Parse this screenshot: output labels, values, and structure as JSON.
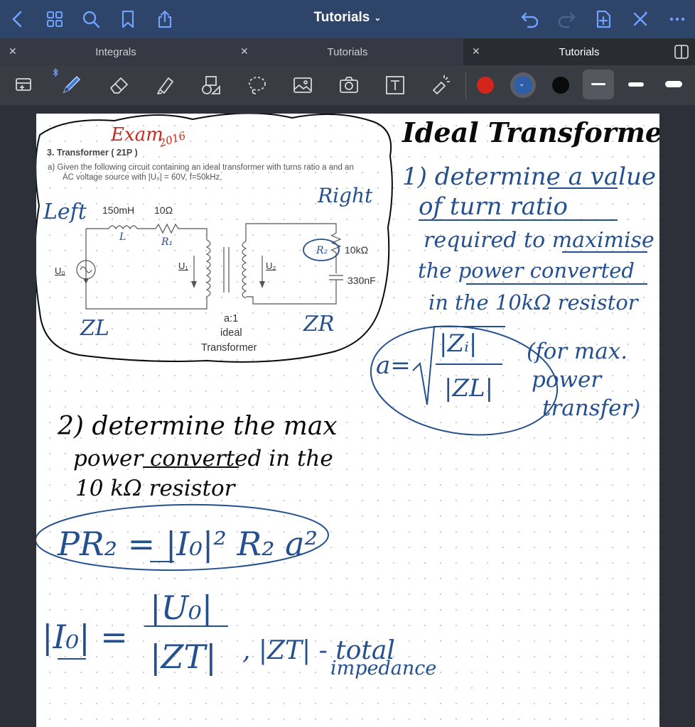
{
  "header": {
    "title": "Tutorials",
    "icons": [
      "back-chevron-icon",
      "grid-icon",
      "search-icon",
      "bookmark-icon",
      "share-icon",
      "undo-icon",
      "redo-icon",
      "add-page-icon",
      "close-x-icon",
      "more-icon"
    ]
  },
  "tabs": [
    {
      "label": "Integrals",
      "active": false
    },
    {
      "label": "Tutorials",
      "active": false
    },
    {
      "label": "Tutorials",
      "active": true
    }
  ],
  "toolbar": {
    "tools": [
      "lasso-select-icon",
      "pen-icon",
      "eraser-icon",
      "highlighter-icon",
      "shapes-icon",
      "lasso-icon",
      "image-icon",
      "camera-icon",
      "text-icon",
      "laser-pointer-icon"
    ],
    "colors": {
      "red": "#d3251c",
      "blue": "#2f5ea8",
      "black": "#0a0a0a"
    }
  },
  "note": {
    "printed": {
      "question": "3.  Transformer  ( 21P )",
      "prompt_a": "a)  Given the following circuit containing an ideal transformer with turns ratio a and an",
      "prompt_b": "AC voltage source with |U₀| = 60V, f=50kHz,",
      "inductor": "150mH",
      "resistor": "10Ω",
      "r2": "10kΩ",
      "capacitor": "330nF",
      "u0": "U₀",
      "u1": "U₁",
      "u2": "U₂",
      "ratio": "a:1",
      "ideal": "ideal",
      "transformer": "Transformer"
    },
    "handwriting": {
      "exam": "Exam",
      "year": "2016",
      "heading": "Ideal Transformer",
      "left": "Left",
      "right": "Right",
      "L": "L",
      "R1": "R₁",
      "R2": "R₂",
      "ZL": "ZL",
      "ZR": "ZR",
      "q1_line1": "1) determine  a value",
      "q1_line2": "of  turn  ratio",
      "q1_line3": "required  to maximise",
      "q1_line4": "the power  converted",
      "q1_line5": "in  the  10kΩ  resistor",
      "formula_a": "a=",
      "formula_num": "|Zᵢ|",
      "formula_den": "|ZL|",
      "note1": "(for max.",
      "note2": "power",
      "note3": "transfer)",
      "q2_line1": "2) determine  the  max",
      "q2_line2": "power  converted  in  the",
      "q2_line3": "10 kΩ  resistor",
      "power_eq": "PR₂ = |I₀|² R₂ a²",
      "current_lhs": "|I₀| =",
      "current_num": "|U₀|",
      "current_den": "|ZT|",
      "zt_label": ", |ZT| - total",
      "impedance": "impedance"
    }
  }
}
